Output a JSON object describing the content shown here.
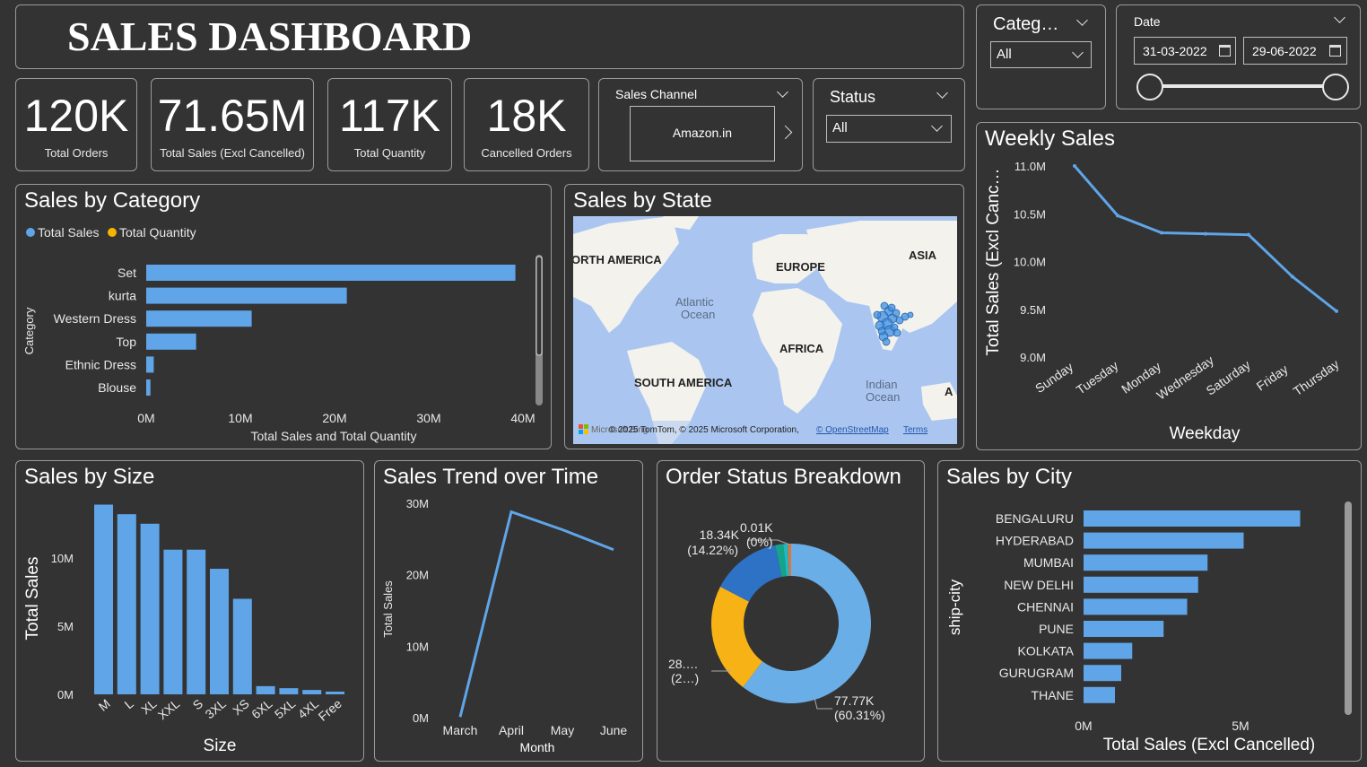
{
  "header": {
    "title": "SALES DASHBOARD"
  },
  "kpis": [
    {
      "value": "120K",
      "label": "Total Orders"
    },
    {
      "value": "71.65M",
      "label": "Total Sales (Excl Cancelled)"
    },
    {
      "value": "117K",
      "label": "Total Quantity"
    },
    {
      "value": "18K",
      "label": "Cancelled Orders"
    }
  ],
  "filters": {
    "sales_channel": {
      "label": "Sales Channel",
      "value": "Amazon.in"
    },
    "status": {
      "label": "Status",
      "value": "All"
    },
    "category": {
      "label": "Categ…",
      "value": "All"
    },
    "date": {
      "label": "Date",
      "start": "31-03-2022",
      "end": "29-06-2022"
    }
  },
  "map": {
    "title": "Sales by State",
    "labels": [
      "ORTH AMERICA",
      "EUROPE",
      "ASIA",
      "Atlantic",
      "Ocean",
      "AFRICA",
      "SOUTH AMERICA",
      "Indian",
      "Ocean",
      "A"
    ],
    "attribution": "© 2025 TomTom, © 2025 Microsoft Corporation,",
    "osm": "© OpenStreetMap",
    "terms": "Terms",
    "brand": "Microsoft Bing",
    "colors": {
      "water": "#aac6f0",
      "land": "#f4f2ec",
      "bubble": "#3d8ee0"
    }
  },
  "chart_data": [
    {
      "id": "category",
      "type": "bar",
      "title": "Sales by Category",
      "legend": [
        {
          "name": "Total Sales",
          "color": "#5fa5e8"
        },
        {
          "name": "Total Quantity",
          "color": "#f5b400"
        }
      ],
      "ylabel": "Category",
      "xlabel": "Total Sales and Total Quantity",
      "categories": [
        "Set",
        "kurta",
        "Western Dress",
        "Top",
        "Ethnic Dress",
        "Blouse"
      ],
      "series": [
        {
          "name": "Total Sales",
          "values": [
            39.2,
            21.3,
            11.2,
            5.3,
            0.8,
            0.45
          ]
        }
      ],
      "xticks": [
        "0M",
        "10M",
        "20M",
        "30M",
        "40M"
      ],
      "xlim": [
        0,
        40
      ]
    },
    {
      "id": "weekly",
      "type": "line",
      "title": "Weekly Sales",
      "xlabel": "Weekday",
      "ylabel": "Total Sales (Excl Canc…",
      "categories": [
        "Sunday",
        "Tuesday",
        "Monday",
        "Wednesday",
        "Saturday",
        "Friday",
        "Thursday"
      ],
      "values": [
        11.0,
        10.48,
        10.3,
        10.29,
        10.28,
        9.84,
        9.48
      ],
      "yticks": [
        "9.0M",
        "9.5M",
        "10.0M",
        "10.5M",
        "11.0M"
      ],
      "ylim": [
        9.0,
        11.0
      ]
    },
    {
      "id": "size",
      "type": "bar",
      "title": "Sales by Size",
      "xlabel": "Size",
      "ylabel": "Total Sales",
      "categories": [
        "M",
        "L",
        "XL",
        "XXL",
        "S",
        "3XL",
        "XS",
        "6XL",
        "5XL",
        "4XL",
        "Free"
      ],
      "values": [
        13.9,
        13.2,
        12.5,
        10.6,
        10.6,
        9.2,
        7.0,
        0.6,
        0.45,
        0.32,
        0.2
      ],
      "yticks": [
        "0M",
        "5M",
        "10M"
      ],
      "ylim": [
        0,
        14
      ]
    },
    {
      "id": "trend",
      "type": "line",
      "title": "Sales Trend over Time",
      "xlabel": "Month",
      "ylabel": "Total Sales",
      "categories": [
        "March",
        "April",
        "May",
        "June"
      ],
      "values": [
        0.1,
        28.8,
        26.3,
        23.5
      ],
      "yticks": [
        "0M",
        "10M",
        "20M",
        "30M"
      ],
      "ylim": [
        0,
        30
      ]
    },
    {
      "id": "status",
      "type": "pie",
      "title": "Order Status Breakdown",
      "slices": [
        {
          "value": 60.31,
          "color": "#6aaee8"
        },
        {
          "value": 22.3,
          "color": "#f7b316"
        },
        {
          "value": 14.22,
          "color": "#2d72c4"
        },
        {
          "value": 1.6,
          "color": "#15a38a"
        },
        {
          "value": 0.9,
          "color": "#1fb9c4"
        },
        {
          "value": 0.67,
          "color": "#e3733b"
        }
      ],
      "labels": {
        "big": [
          "77.77K",
          "(60.31%)"
        ],
        "mid": [
          "28.…",
          "(2…)"
        ],
        "small": [
          "18.34K",
          "(14.22%)"
        ],
        "tiny": [
          "0.01K",
          "(0%)"
        ]
      }
    },
    {
      "id": "city",
      "type": "bar",
      "title": "Sales by City",
      "xlabel": "Total Sales (Excl Cancelled)",
      "ylabel": "ship-city",
      "categories": [
        "BENGALURU",
        "HYDERABAD",
        "MUMBAI",
        "NEW DELHI",
        "CHENNAI",
        "PUNE",
        "KOLKATA",
        "GURUGRAM",
        "THANE"
      ],
      "values": [
        6.9,
        5.1,
        3.95,
        3.65,
        3.3,
        2.55,
        1.55,
        1.2,
        1.0
      ],
      "xticks": [
        "0M",
        "5M"
      ],
      "xlim": [
        0,
        5
      ]
    }
  ]
}
